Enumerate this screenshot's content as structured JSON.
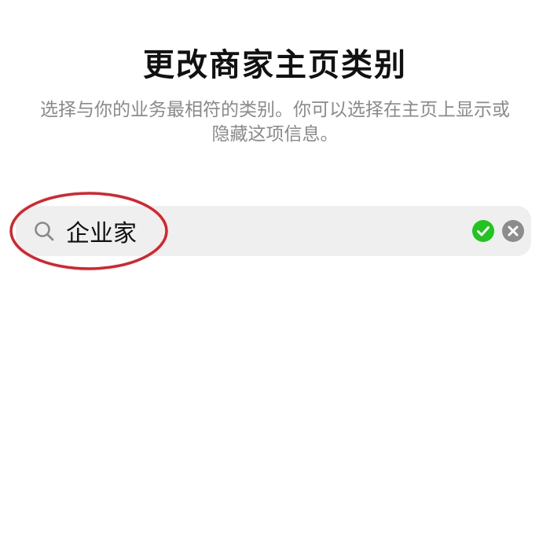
{
  "header": {
    "title": "更改商家主页类别",
    "subtitle": "选择与你的业务最相符的类别。你可以选择在主页上显示或隐藏这项信息。"
  },
  "search": {
    "value": "企业家",
    "icon": "search-icon",
    "status_icon": "check-circle-icon",
    "clear_icon": "clear-icon"
  },
  "colors": {
    "search_bg": "#efefef",
    "check_green": "#22c41f",
    "clear_gray": "#8c8c8c",
    "annotation_red": "#d8232a"
  }
}
